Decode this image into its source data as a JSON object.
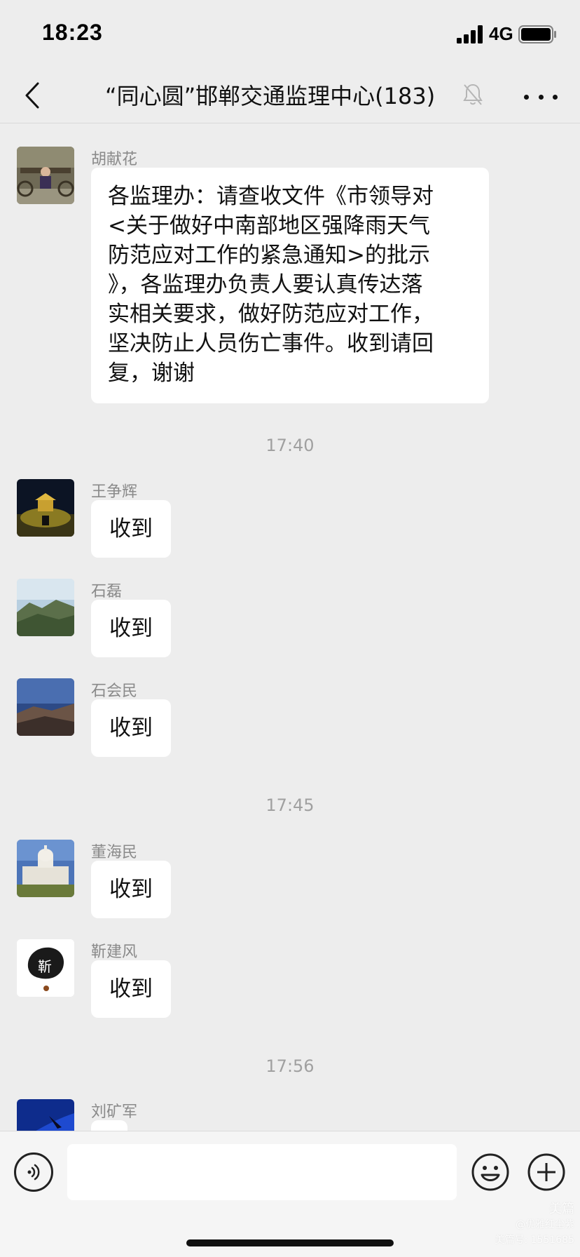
{
  "status_bar": {
    "time": "18:23",
    "network": "4G",
    "signal_icon": "cellular-signal-icon",
    "battery_icon": "battery-icon"
  },
  "nav": {
    "title": "“同心圆”邯郸交通监理中心(183)",
    "back_icon": "chevron-left-icon",
    "mute_icon": "bell-muted-icon",
    "more_icon": "more-dots-icon"
  },
  "messages": [
    {
      "sender": "胡献花",
      "lines": [
        "各监理办：请查收文件《市领导对",
        "<关于做好中南部地区强降雨天气",
        "防范应对工作的紧急通知>的批示",
        "》，各监理办负责人要认真传达落",
        "实相关要求，做好防范应对工作，",
        "坚决防止人员伤亡事件。收到请回",
        "复，谢谢"
      ]
    },
    {
      "timestamp": "17:40"
    },
    {
      "sender": "王争辉",
      "text": "收到"
    },
    {
      "sender": "石磊",
      "text": "收到"
    },
    {
      "sender": "石会民",
      "text": "收到"
    },
    {
      "timestamp": "17:45"
    },
    {
      "sender": "董海民",
      "text": "收到"
    },
    {
      "sender": "靳建风",
      "text": "收到",
      "avatar_text": "靳"
    },
    {
      "timestamp": "17:56"
    },
    {
      "sender": "刘矿军",
      "text": ""
    }
  ],
  "input_bar": {
    "voice_icon": "voice-icon",
    "emoji_icon": "emoji-icon",
    "plus_icon": "plus-circle-icon",
    "input_value": ""
  },
  "watermark": {
    "brand": "美篇",
    "line1": "@优雅红尘紫",
    "line2": "美篇号: 1551685"
  },
  "colors": {
    "background": "#ededed",
    "bubble": "#ffffff",
    "sender": "#8a8a8a",
    "timestamp": "#a0a0a0"
  }
}
